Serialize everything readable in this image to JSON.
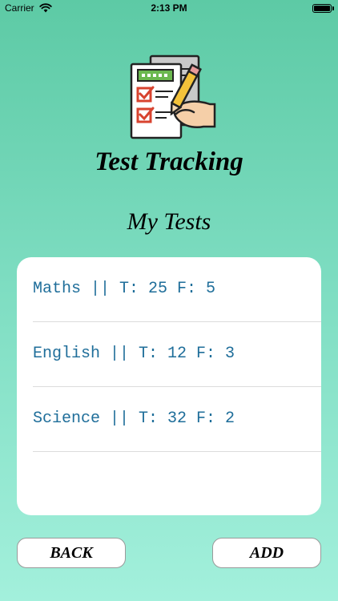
{
  "status_bar": {
    "carrier": "Carrier",
    "time": "2:13 PM",
    "battery_level": 1.0
  },
  "header": {
    "app_title": "Test Tracking",
    "logo_icon": "test-checklist-icon"
  },
  "main": {
    "section_title": "My Tests",
    "tests": [
      {
        "label": "Maths || T: 25 F: 5"
      },
      {
        "label": "English || T: 12 F: 3"
      },
      {
        "label": "Science || T: 32 F: 2"
      }
    ]
  },
  "footer": {
    "back_label": "BACK",
    "add_label": "ADD"
  },
  "colors": {
    "background_top": "#5dcaa5",
    "background_bottom": "#a3f0dc",
    "list_text": "#1f6e9a"
  }
}
